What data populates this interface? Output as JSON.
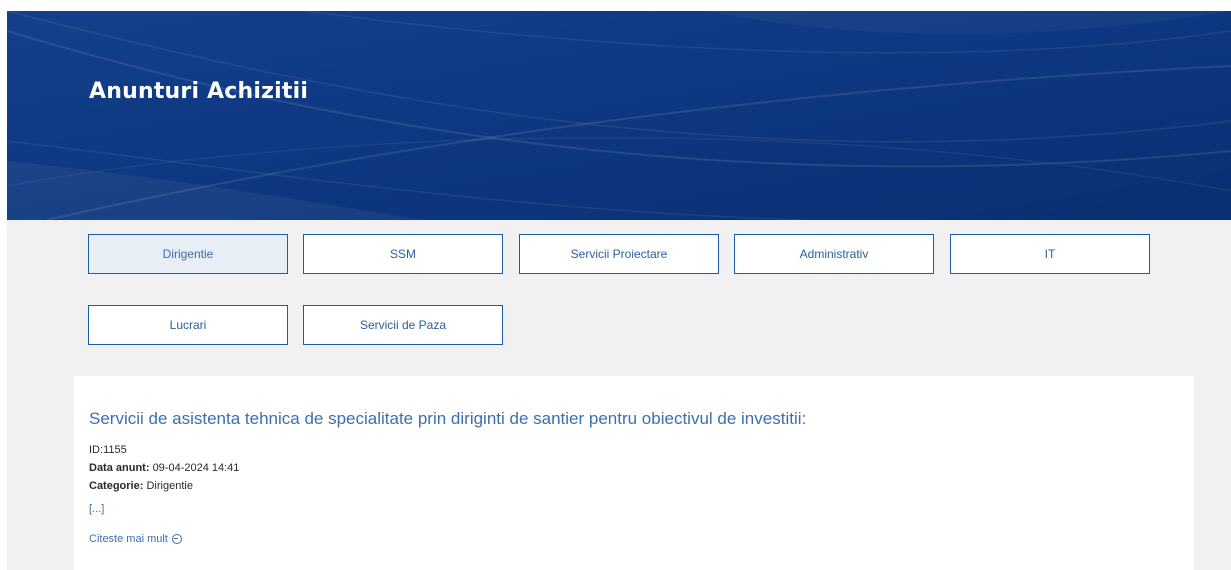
{
  "header": {
    "title": "Anunturi Achizitii"
  },
  "categories": [
    {
      "label": "Dirigentie",
      "active": true
    },
    {
      "label": "SSM",
      "active": false
    },
    {
      "label": "Servicii Proiectare",
      "active": false
    },
    {
      "label": "Administrativ",
      "active": false
    },
    {
      "label": "IT",
      "active": false
    },
    {
      "label": "Lucrari",
      "active": false
    },
    {
      "label": "Servicii de Paza",
      "active": false
    }
  ],
  "announcement": {
    "title": "Servicii de asistenta tehnica de specialitate prin diriginti de santier pentru obiectivul de investitii:",
    "id_label": "ID:",
    "id_value": "1155",
    "date_label": "Data anunt:",
    "date_value": "09-04-2024 14:41",
    "category_label": "Categorie:",
    "category_value": "Dirigentie",
    "ellipsis": "[...]",
    "read_more": "Citeste mai mult"
  },
  "colors": {
    "hero_blue": "#0f3c86",
    "accent_blue": "#1d5aa8",
    "link_blue": "#3c6fb0",
    "background_gray": "#f1f1f1"
  }
}
